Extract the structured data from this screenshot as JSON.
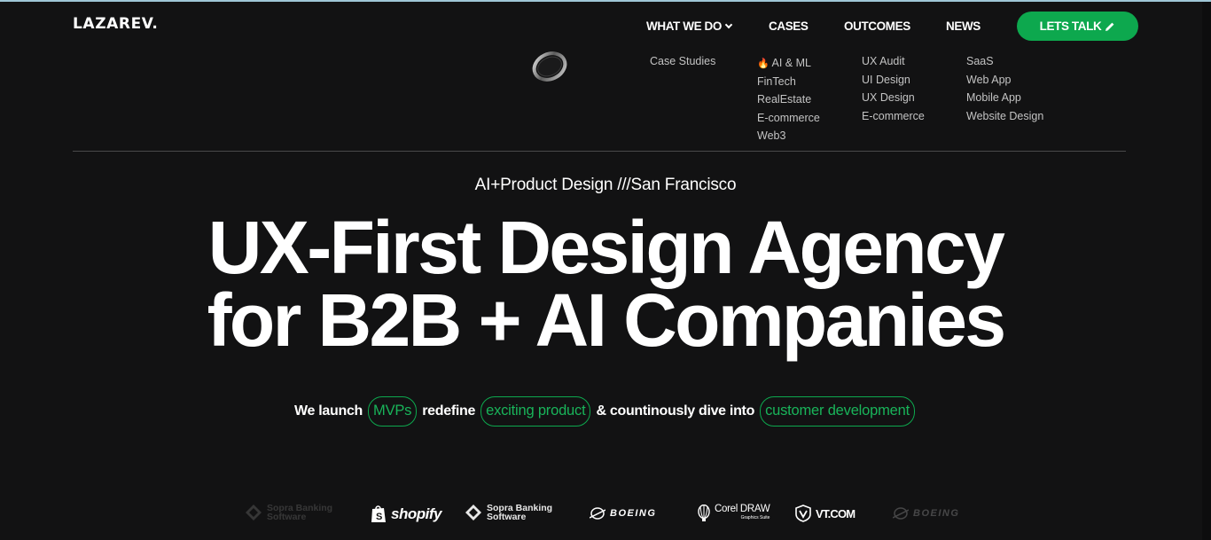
{
  "header": {
    "logo": "LAZAREV.",
    "nav": {
      "what_we_do": "WHAT WE DO",
      "cases": "CASES",
      "outcomes": "OUTCOMES",
      "news": "NEWS"
    },
    "cta_label": "LETS TALK",
    "cta_icon": "pencil-icon",
    "accent_color": "#0da84e"
  },
  "dropdown": {
    "col1": [
      "Case Studies"
    ],
    "col2": [
      "AI & ML",
      "FinTech",
      "RealEstate",
      "E-commerce",
      "Web3"
    ],
    "col3": [
      "UX Audit",
      "UI Design",
      "UX Design",
      "E-commerce"
    ],
    "col4": [
      "SaaS",
      "Web App",
      "Mobile App",
      "Website Design"
    ]
  },
  "hero": {
    "eyebrow": "AI+Product Design ///San Francisco",
    "headline_line1": "UX-First Design Agency",
    "headline_line2": "for B2B + AI Companies",
    "sub": {
      "t1": "We launch",
      "p1": "MVPs",
      "t2": "redefine",
      "p2": "exciting product",
      "t3": "& countinously dive into",
      "p3": "customer development"
    }
  },
  "clients": {
    "sopra_1": "Sopra Banking",
    "sopra_2": "Software",
    "shopify": "shopify",
    "boeing": "BOEING",
    "corel": "Corel DRAW",
    "corel_sub": "Graphics Suite",
    "vt": "VT.COM"
  }
}
